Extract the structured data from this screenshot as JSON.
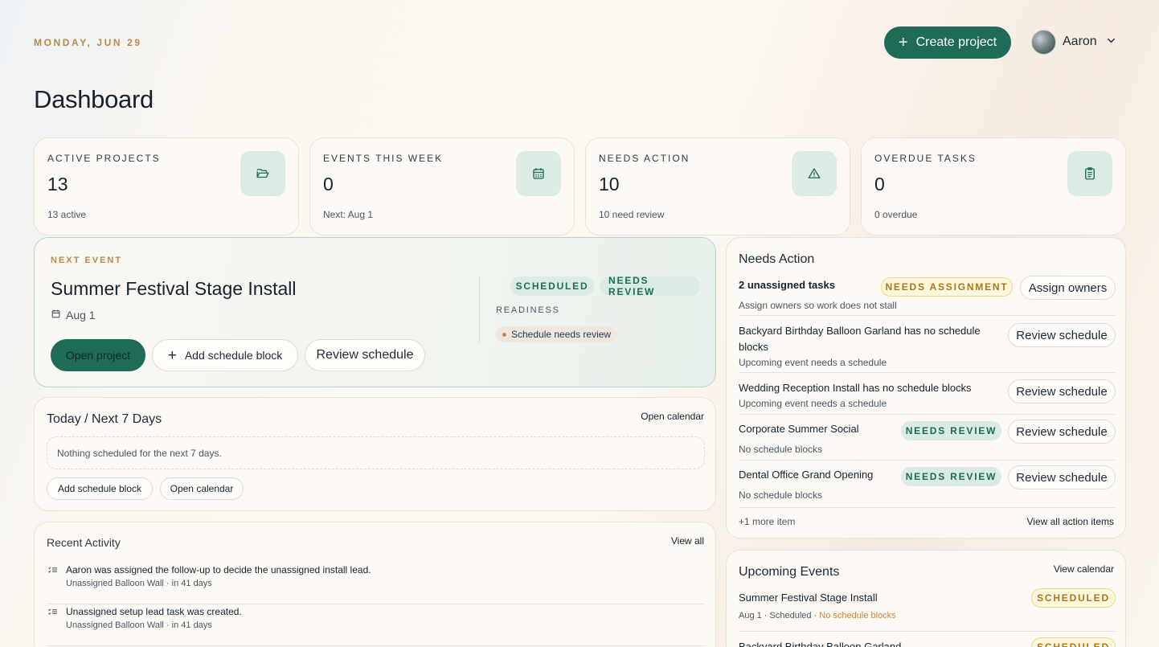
{
  "header": {
    "date": "MONDAY, JUN 29",
    "title": "Dashboard",
    "create_label": "Create project",
    "user_name": "Aaron"
  },
  "stats": [
    {
      "label": "ACTIVE PROJECTS",
      "value": "13",
      "sub": "13 active",
      "icon": "folder-open-icon"
    },
    {
      "label": "EVENTS THIS WEEK",
      "value": "0",
      "sub": "Next: Aug 1",
      "icon": "calendar-icon"
    },
    {
      "label": "NEEDS ACTION",
      "value": "10",
      "sub": "10 need review",
      "icon": "warning-icon"
    },
    {
      "label": "OVERDUE TASKS",
      "value": "0",
      "sub": "0 overdue",
      "icon": "clipboard-icon"
    }
  ],
  "next_event": {
    "eyebrow": "NEXT EVENT",
    "name": "Summer Festival Stage Install",
    "date": "Aug 1",
    "tags": [
      "SCHEDULED",
      "NEEDS REVIEW"
    ],
    "readiness_label": "READINESS",
    "readiness_chip": "Schedule needs review",
    "open_label": "Open project",
    "add_label": "Add schedule block",
    "review_label": "Review schedule"
  },
  "today": {
    "title": "Today / Next 7 Days",
    "open_calendar": "Open calendar",
    "empty": "Nothing scheduled for the next 7 days.",
    "add_label": "Add schedule block",
    "calendar_label": "Open calendar"
  },
  "activity": {
    "title": "Recent Activity",
    "view_all": "View all",
    "items": [
      {
        "text": "Aaron was assigned the follow-up to decide the unassigned install lead.",
        "meta": "Unassigned Balloon Wall · in 41 days"
      },
      {
        "text": "Unassigned setup lead task was created.",
        "meta": "Unassigned Balloon Wall · in 41 days"
      }
    ]
  },
  "needs_action": {
    "title": "Needs Action",
    "items": [
      {
        "title": "2 unassigned tasks",
        "sub": "Assign owners so work does not stall",
        "tag": "NEEDS ASSIGNMENT",
        "button": "Assign owners"
      },
      {
        "title": "Backyard Birthday Balloon Garland has no schedule blocks",
        "sub": "Upcoming event needs a schedule",
        "tag": "",
        "button": "Review schedule"
      },
      {
        "title": "Wedding Reception Install has no schedule blocks",
        "sub": "Upcoming event needs a schedule",
        "tag": "",
        "button": "Review schedule"
      },
      {
        "title": "Corporate Summer Social",
        "sub": "No schedule blocks",
        "tag": "NEEDS REVIEW",
        "button": "Review schedule"
      },
      {
        "title": "Dental Office Grand Opening",
        "sub": "No schedule blocks",
        "tag": "NEEDS REVIEW",
        "button": "Review schedule"
      }
    ],
    "more": "+1 more item",
    "view_all": "View all action items"
  },
  "upcoming": {
    "title": "Upcoming Events",
    "view_calendar": "View calendar",
    "items": [
      {
        "title": "Summer Festival Stage Install",
        "meta": "Aug 1 · Scheduled · ",
        "warn": "No schedule blocks",
        "tag": "SCHEDULED"
      },
      {
        "title": "Backyard Birthday Balloon Garland",
        "meta": "",
        "warn": "",
        "tag": "SCHEDULED"
      }
    ]
  },
  "colors": {
    "accent": "#1e6b57",
    "eyebrow": "#b8884e",
    "tag_green_bg": "#d9ebe2",
    "tag_yellow_bg": "#fff7dc"
  }
}
